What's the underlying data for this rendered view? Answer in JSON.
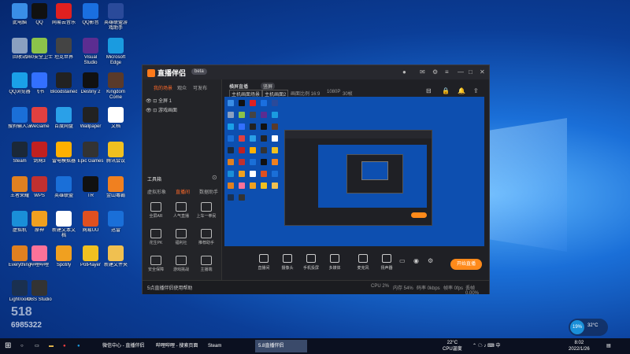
{
  "desktop": {
    "icons": [
      {
        "label": "此电脑",
        "color": "#3a8ee6"
      },
      {
        "label": "QQ",
        "color": "#111111"
      },
      {
        "label": "网易云音乐",
        "color": "#e02020"
      },
      {
        "label": "QQ影音",
        "color": "#1a6fe0"
      },
      {
        "label": "英雄联盟游戏助手",
        "color": "#2a4a9a"
      },
      {
        "label": "回收站",
        "color": "#8aa0c0"
      },
      {
        "label": "360安全卫士",
        "color": "#8bc34a"
      },
      {
        "label": "坦克世界",
        "color": "#444444"
      },
      {
        "label": "Visual Studio",
        "color": "#5c2d91"
      },
      {
        "label": "Microsoft Edge",
        "color": "#1a9be0"
      },
      {
        "label": "QQ浏览器",
        "color": "#1aa0e8"
      },
      {
        "label": "飞书",
        "color": "#3370ff"
      },
      {
        "label": "Bloodstained",
        "color": "#222222"
      },
      {
        "label": "Destiny 2",
        "color": "#111111"
      },
      {
        "label": "Kingdom Come",
        "color": "#5a3a2a"
      },
      {
        "label": "搜狗输入法",
        "color": "#1a6fd8"
      },
      {
        "label": "WeGame",
        "color": "#e04040"
      },
      {
        "label": "百度网盘",
        "color": "#2aa0e8"
      },
      {
        "label": "Wallpaper",
        "color": "#222222"
      },
      {
        "label": "文档",
        "color": "#ffffff"
      },
      {
        "label": "Steam",
        "color": "#1b2838"
      },
      {
        "label": "剑网3",
        "color": "#c02020"
      },
      {
        "label": "雷电模拟器",
        "color": "#ffb000"
      },
      {
        "label": "Epic Games",
        "color": "#333333"
      },
      {
        "label": "腾讯会议",
        "color": "#f0c020"
      },
      {
        "label": "王者荣耀",
        "color": "#e08020"
      },
      {
        "label": "WPS",
        "color": "#c03030"
      },
      {
        "label": "英雄联盟",
        "color": "#1a6fd8"
      },
      {
        "label": "TR",
        "color": "#111111"
      },
      {
        "label": "金山毒霸",
        "color": "#f08020"
      },
      {
        "label": "虚拟机",
        "color": "#1a8fd8"
      },
      {
        "label": "原神",
        "color": "#f0a020"
      },
      {
        "label": "新建文本文档",
        "color": "#ffffff"
      },
      {
        "label": "网易UU",
        "color": "#e05020"
      },
      {
        "label": "迅雷",
        "color": "#1a6fd8"
      },
      {
        "label": "Everything",
        "color": "#e08020"
      },
      {
        "label": "哔哩哔哩",
        "color": "#fb7299"
      },
      {
        "label": "Spotify",
        "color": "#f0a020"
      },
      {
        "label": "PotPlayer",
        "color": "#f0c020"
      },
      {
        "label": "新建文件夹",
        "color": "#f0c050"
      },
      {
        "label": "Lightroom",
        "color": "#1a3050"
      },
      {
        "label": "OBS Studio",
        "color": "#333333"
      }
    ],
    "watermark_line1": "518",
    "watermark_line2": "6985322"
  },
  "live_window": {
    "title": "直播伴侣",
    "version": "beta",
    "left_tabs": [
      "我的场景",
      "观众",
      "可发布"
    ],
    "scenes": [
      "全屏 1",
      "游戏画面"
    ],
    "tools_header": "工具箱",
    "tool_categories": [
      "虚拟形象",
      "直播间",
      "数据助手"
    ],
    "tools": [
      "全屏AR",
      "人气直播",
      "上车一拳民",
      "花生PK",
      "福利社",
      "推荐助手",
      "安全保障",
      "游戏挑战",
      "主播端"
    ],
    "status_left": "5点直播伴侣使用帮助",
    "status_items": [
      "CPU 2%",
      "内存 54%",
      "码率 0kbps",
      "帧率 0fps",
      "丢帧 0.00%"
    ],
    "preview_tabs": [
      "横屏直播",
      "竖屏"
    ],
    "preview_sub": [
      "主机画面场景",
      "主机画面2"
    ],
    "preview_stats": [
      "画面比例 16:9",
      "1080P",
      "30帧"
    ],
    "bottom_controls": [
      "直播间",
      "摄像头",
      "手机投屏",
      "多媒体",
      "麦克风",
      "扬声器"
    ],
    "start_label": "开始直播"
  },
  "taskbar": {
    "tasks": [
      "微信中心 - 直播伴侣",
      "哔哩哔哩 - 搜索页面",
      "Steam",
      "5.8直播伴侣"
    ],
    "weather_temp": "22°C",
    "weather_text": "CPU温度",
    "time": "8:02",
    "date": "2022/1/26",
    "cpu_percent": "19%",
    "cpu_temp": "32°C"
  }
}
